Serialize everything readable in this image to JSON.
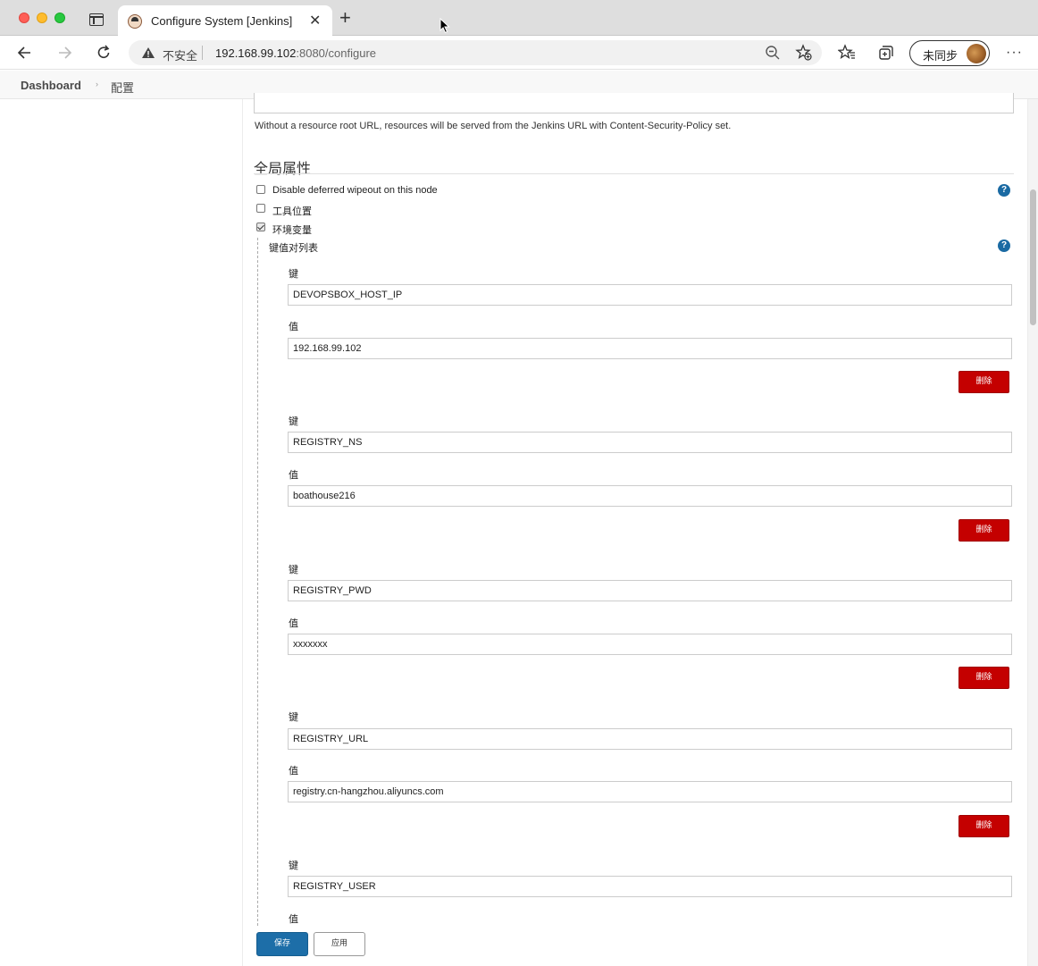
{
  "browser": {
    "tab_title": "Configure System [Jenkins]",
    "tab_close": "✕",
    "new_tab": "+",
    "url_warning": "不安全",
    "url_host": "192.168.99.102",
    "url_path": ":8080/configure",
    "profile_label": "未同步",
    "menu": "···"
  },
  "breadcrumb": {
    "home": "Dashboard",
    "separator": "›",
    "current": "配置"
  },
  "page": {
    "resource_root_description": "Without a resource root URL, resources will be served from the Jenkins URL with Content-Security-Policy set.",
    "section_title": "全局属性",
    "options": [
      {
        "label": "Disable deferred wipeout on this node",
        "checked": false
      },
      {
        "label": "工具位置",
        "checked": false
      },
      {
        "label": "环境变量",
        "checked": true
      }
    ],
    "kv_list_title": "键值对列表",
    "help": "?",
    "key_label": "键",
    "value_label": "值",
    "delete_label": "删除",
    "env_vars": [
      {
        "key": "DEVOPSBOX_HOST_IP",
        "value": "192.168.99.102"
      },
      {
        "key": "REGISTRY_NS",
        "value": "boathouse216"
      },
      {
        "key": "REGISTRY_PWD",
        "value": "xxxxxxx"
      },
      {
        "key": "REGISTRY_URL",
        "value": "registry.cn-hangzhou.aliyuncs.com"
      },
      {
        "key": "REGISTRY_USER",
        "value": ""
      }
    ],
    "save_label": "保存",
    "apply_label": "应用"
  },
  "colors": {
    "primary": "#1d6ea8",
    "danger": "#c40000",
    "help": "#1a6aa3"
  }
}
